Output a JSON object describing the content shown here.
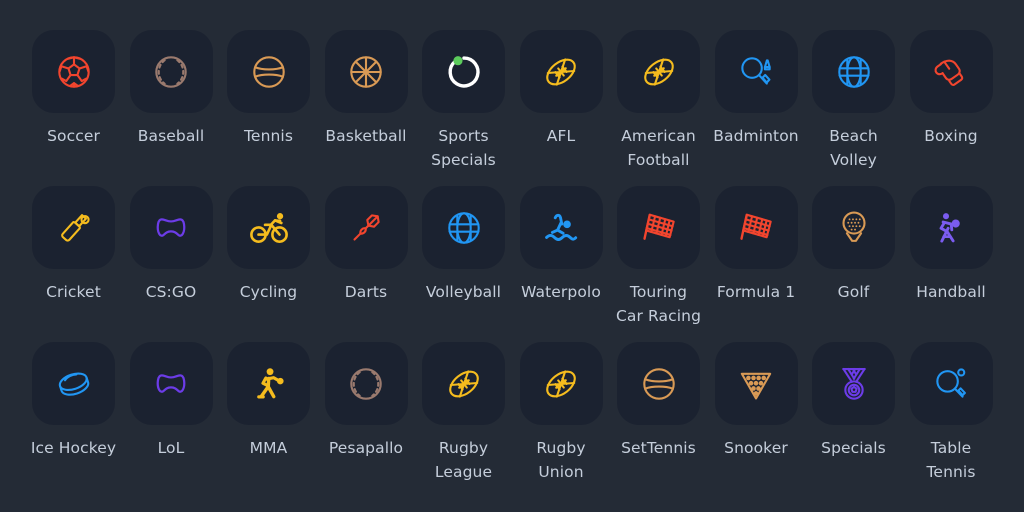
{
  "page": {
    "background_color": "#242b36",
    "tile_color": "#1b2230",
    "label_color": "#c5cedb",
    "columns": 10,
    "rows": 3
  },
  "palette": {
    "red": "#f2452e",
    "brown": "#9a7a6e",
    "orange": "#d99a55",
    "amber": "#f0a800",
    "yellow": "#f5bc1e",
    "blue": "#1e88e5",
    "blue_light": "#2196f3",
    "purple": "#6c3ce8",
    "violet": "#7b5cf0",
    "green": "#5ccc5c",
    "white": "#ffffff"
  },
  "rows": [
    {
      "items": [
        {
          "label": "Soccer",
          "icon": "soccer-ball-icon",
          "color": "#f2452e"
        },
        {
          "label": "Baseball",
          "icon": "baseball-icon",
          "color": "#9a7a6e"
        },
        {
          "label": "Tennis",
          "icon": "tennis-ball-icon",
          "color": "#d99a55"
        },
        {
          "label": "Basketball",
          "icon": "basketball-icon",
          "color": "#d99a55"
        },
        {
          "label": "Sports\nSpecials",
          "icon": "progress-circle-icon",
          "color": "#ffffff",
          "accent": "#5ccc5c"
        },
        {
          "label": "AFL",
          "icon": "football-icon",
          "color": "#f5bc1e"
        },
        {
          "label": "American\nFootball",
          "icon": "football-icon",
          "color": "#f5bc1e"
        },
        {
          "label": "Badminton",
          "icon": "badminton-racket-icon",
          "color": "#2196f3"
        },
        {
          "label": "Beach\nVolley",
          "icon": "volleyball-icon",
          "color": "#2196f3"
        },
        {
          "label": "Boxing",
          "icon": "boxing-gloves-icon",
          "color": "#f2452e"
        }
      ]
    },
    {
      "items": [
        {
          "label": "Cricket",
          "icon": "cricket-bat-icon",
          "color": "#f5bc1e"
        },
        {
          "label": "CS:GO",
          "icon": "gamepad-icon",
          "color": "#6c3ce8"
        },
        {
          "label": "Cycling",
          "icon": "cyclist-icon",
          "color": "#f5bc1e"
        },
        {
          "label": "Darts",
          "icon": "dart-icon",
          "color": "#f2452e"
        },
        {
          "label": "Volleyball",
          "icon": "volleyball-icon",
          "color": "#2196f3"
        },
        {
          "label": "Waterpolo",
          "icon": "waterpolo-player-icon",
          "color": "#2196f3"
        },
        {
          "label": "Touring\nCar Racing",
          "icon": "checkered-flag-icon",
          "color": "#f2452e"
        },
        {
          "label": "Formula 1",
          "icon": "checkered-flag-icon",
          "color": "#f2452e"
        },
        {
          "label": "Golf",
          "icon": "golf-ball-tee-icon",
          "color": "#d99a55"
        },
        {
          "label": "Handball",
          "icon": "handball-player-icon",
          "color": "#7b5cf0"
        }
      ]
    },
    {
      "items": [
        {
          "label": "Ice Hockey",
          "icon": "hockey-puck-icon",
          "color": "#2196f3"
        },
        {
          "label": "LoL",
          "icon": "gamepad-icon",
          "color": "#6c3ce8"
        },
        {
          "label": "MMA",
          "icon": "fighter-icon",
          "color": "#f5bc1e"
        },
        {
          "label": "Pesapallo",
          "icon": "baseball-icon",
          "color": "#9a7a6e"
        },
        {
          "label": "Rugby\nLeague",
          "icon": "football-icon",
          "color": "#f5bc1e"
        },
        {
          "label": "Rugby\nUnion",
          "icon": "football-icon",
          "color": "#f5bc1e"
        },
        {
          "label": "SetTennis",
          "icon": "tennis-ball-icon",
          "color": "#d99a55"
        },
        {
          "label": "Snooker",
          "icon": "snooker-rack-icon",
          "color": "#d99a55"
        },
        {
          "label": "Specials",
          "icon": "medal-icon",
          "color": "#6c3ce8"
        },
        {
          "label": "Table\nTennis",
          "icon": "table-tennis-paddle-icon",
          "color": "#2196f3"
        }
      ]
    }
  ]
}
